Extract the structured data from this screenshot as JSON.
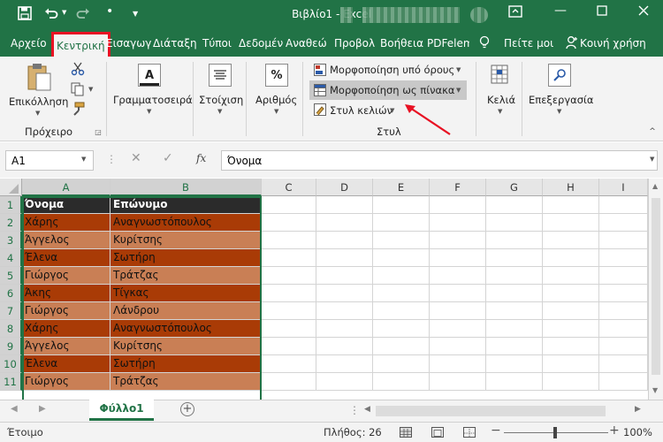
{
  "title_bar": {
    "title": "Βιβλίο1  -  Excel",
    "save_icon": "save-icon",
    "undo_icon": "undo-icon",
    "redo_icon": "redo-icon"
  },
  "tabs": [
    {
      "label": "Αρχείο"
    },
    {
      "label": "Κεντρική",
      "active": true
    },
    {
      "label": "Εισαγωγ"
    },
    {
      "label": "Διάταξη"
    },
    {
      "label": "Τύποι"
    },
    {
      "label": "Δεδομέν"
    },
    {
      "label": "Αναθεώ"
    },
    {
      "label": "Προβολ"
    },
    {
      "label": "Βοήθεια"
    },
    {
      "label": "PDFelem"
    },
    {
      "label": "Πείτε μοι"
    },
    {
      "label": "Κοινή χρήση"
    }
  ],
  "ribbon": {
    "paste_label": "Επικόλληση",
    "clipboard_group": "Πρόχειρο",
    "font_label": "Γραμματοσειρά",
    "font_icon_text": "A",
    "alignment_label": "Στοίχιση",
    "number_label": "Αριθμός",
    "number_icon_text": "%",
    "conditional_formatting": "Μορφοποίηση υπό όρους",
    "format_as_table": "Μορφοποίηση ως πίνακα",
    "cell_styles": "Στυλ κελιών",
    "styles_group": "Στυλ",
    "cells_label": "Κελιά",
    "editing_label": "Επεξεργασία"
  },
  "formula_bar": {
    "name_box": "A1",
    "fx_label": "fx",
    "formula": "Όνομα"
  },
  "grid": {
    "columns": [
      "A",
      "B",
      "C",
      "D",
      "E",
      "F",
      "G",
      "H",
      "I"
    ],
    "row_numbers": [
      "1",
      "2",
      "3",
      "4",
      "5",
      "6",
      "7",
      "8",
      "9",
      "10",
      "11"
    ],
    "header_row": [
      "Όνομα",
      "Επώνυμο"
    ],
    "data_rows": [
      [
        "Χάρης",
        "Αναγνωστόπουλος"
      ],
      [
        "Άγγελος",
        "Κυρίτσης"
      ],
      [
        "Έλενα",
        "Σωτήρη"
      ],
      [
        "Γιώργος",
        "Τράτζας"
      ],
      [
        "Άκης",
        "Τίγκας"
      ],
      [
        "Γιώργος",
        "Λάνδρου"
      ],
      [
        "Χάρης",
        "Αναγνωστόπουλος"
      ],
      [
        "Άγγελος",
        "Κυρίτσης"
      ],
      [
        "Έλενα",
        "Σωτήρη"
      ],
      [
        "Γιώργος",
        "Τράτζας"
      ]
    ],
    "colors": {
      "header_bg": "#2b2b2b",
      "header_text": "#ffffff",
      "band_dark": "#a93b06",
      "band_light": "#c97f55"
    }
  },
  "sheet": {
    "tab_label": "Φύλλο1",
    "add_sheet_icon": "plus-icon"
  },
  "status": {
    "ready": "Έτοιμο",
    "count": "Πλήθος: 26",
    "zoom": "100%"
  },
  "accent": "#217346",
  "highlight": "#e81123"
}
